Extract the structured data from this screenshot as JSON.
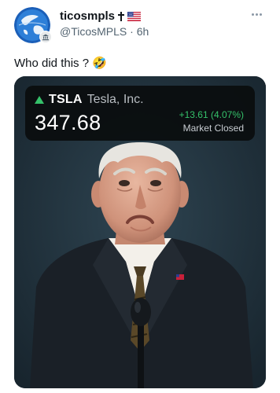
{
  "post": {
    "author_name": "ticosmpls",
    "author_handle": "@TicosMPLS",
    "separator": "·",
    "time": "6h",
    "text": "Who did this ?",
    "emoji": "🤣"
  },
  "icons": {
    "avatar": "globe-logo",
    "badge": "government-badge-icon",
    "cross": "latin-cross-icon",
    "flag": "us-flag-icon",
    "more": "more-options-icon"
  },
  "ticker": {
    "symbol": "TSLA",
    "company": "Tesla, Inc.",
    "price": "347.68",
    "change": "+13.61 (4.07%)",
    "status": "Market Closed",
    "direction": "up"
  },
  "colors": {
    "up_green": "#35c16a",
    "card_bg": "#0a0d0e",
    "backdrop": "#233440"
  }
}
